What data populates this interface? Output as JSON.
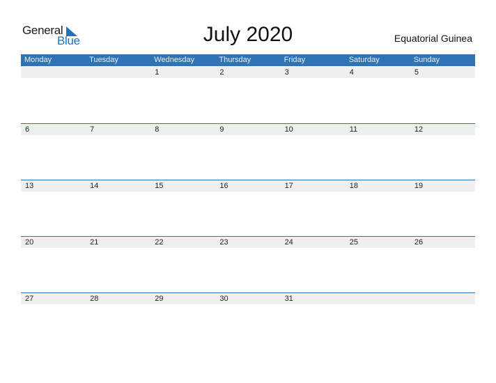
{
  "logo": {
    "line1": "General",
    "line2": "Blue"
  },
  "title": "July 2020",
  "country": "Equatorial Guinea",
  "weekdays": [
    "Monday",
    "Tuesday",
    "Wednesday",
    "Thursday",
    "Friday",
    "Saturday",
    "Sunday"
  ],
  "weeks": [
    [
      "",
      "",
      "1",
      "2",
      "3",
      "4",
      "5"
    ],
    [
      "6",
      "7",
      "8",
      "9",
      "10",
      "11",
      "12"
    ],
    [
      "13",
      "14",
      "15",
      "16",
      "17",
      "18",
      "19"
    ],
    [
      "20",
      "21",
      "22",
      "23",
      "24",
      "25",
      "26"
    ],
    [
      "27",
      "28",
      "29",
      "30",
      "31",
      "",
      ""
    ]
  ],
  "colors": {
    "accent": "#2e74b5",
    "day_bar": "#efefef"
  }
}
